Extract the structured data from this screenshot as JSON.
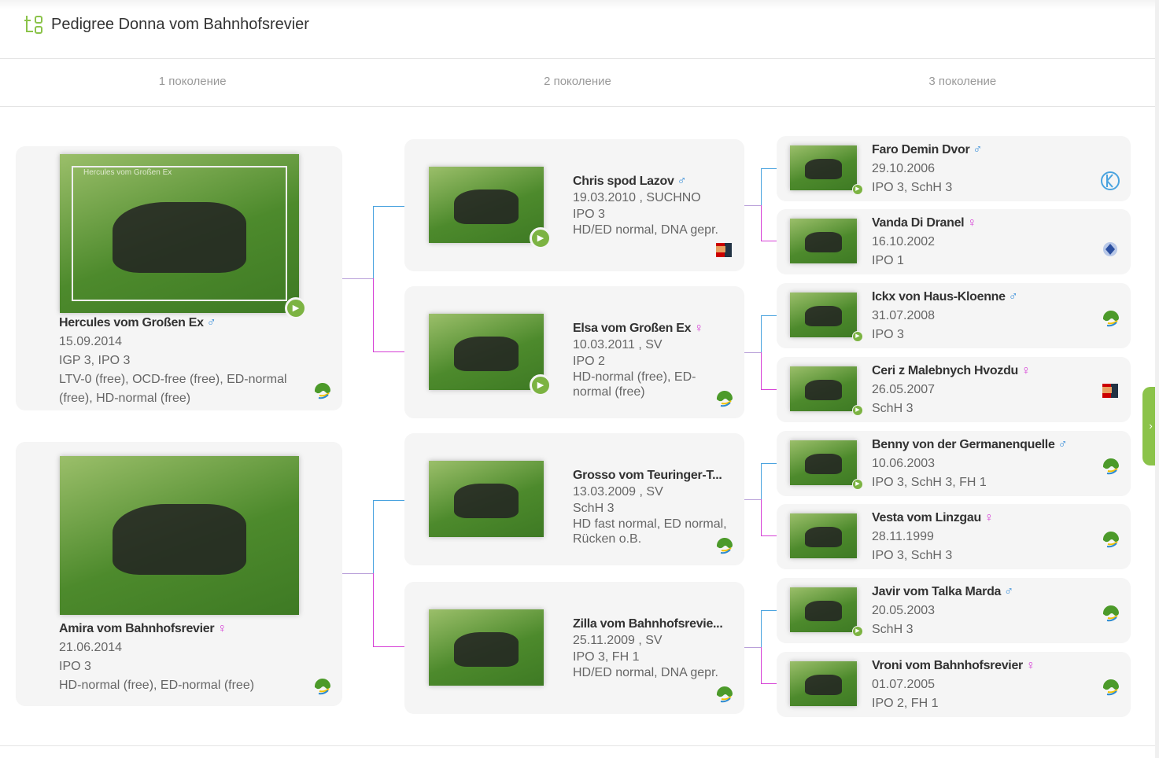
{
  "header": {
    "title": "Pedigree Donna vom Bahnhofsrevier",
    "icon": "pedigree-tree-icon"
  },
  "tabs": [
    "1 поколение",
    "2 поколение",
    "3 поколение"
  ],
  "colors": {
    "male_line": "#4aa3df",
    "female_line": "#d63fd6",
    "accent": "#8bc34a"
  },
  "gen1": [
    {
      "name": "Hercules vom Großen Ex",
      "sex": "♂",
      "lines": [
        "15.09.2014",
        "IGP 3, IPO 3",
        "LTV-0 (free), OCD-free (free), ED-normal (free), HD-normal (free)"
      ],
      "video": true,
      "club": "sv",
      "caption": "Hercules vom Großen Ex"
    },
    {
      "name": "Amira vom Bahnhofsrevier",
      "sex": "♀",
      "lines": [
        "21.06.2014",
        "IPO 3",
        "HD-normal (free), ED-normal (free)"
      ],
      "video": false,
      "club": "sv"
    }
  ],
  "gen2": [
    {
      "name": "Chris spod Lazov",
      "sex": "♂",
      "lines": [
        "19.03.2010 , SUCHNO",
        "IPO 3",
        "HD/ED normal, DNA gepr."
      ],
      "video": true,
      "club": "cmku"
    },
    {
      "name": "Elsa vom Großen Ex",
      "sex": "♀",
      "lines": [
        "10.03.2011 , SV",
        "IPO 2",
        "HD-normal (free), ED-normal (free)"
      ],
      "video": true,
      "club": "sv"
    },
    {
      "name": "Grosso vom Teuringer-T...",
      "sex": "",
      "lines": [
        "13.03.2009 , SV",
        "SchH 3",
        "HD fast normal, ED normal, Rücken o.B."
      ],
      "video": false,
      "club": "sv"
    },
    {
      "name": "Zilla vom Bahnhofsrevie...",
      "sex": "",
      "lines": [
        "25.11.2009 , SV",
        "IPO 3, FH 1",
        "HD/ED normal, DNA gepr."
      ],
      "video": false,
      "club": "sv"
    }
  ],
  "gen3": [
    {
      "name": "Faro Demin Dvor",
      "sex": "♂",
      "lines": [
        "29.10.2006",
        "IPO 3, SchH 3"
      ],
      "video": true,
      "club": "k"
    },
    {
      "name": "Vanda Di Dranel",
      "sex": "♀",
      "lines": [
        "16.10.2002",
        "IPO 1"
      ],
      "video": false,
      "club": "enci"
    },
    {
      "name": "Ickx von Haus-Kloenne",
      "sex": "♂",
      "lines": [
        "31.07.2008",
        "IPO 3"
      ],
      "video": true,
      "club": "sv"
    },
    {
      "name": "Ceri z Malebnych Hvozdu",
      "sex": "♀",
      "lines": [
        "26.05.2007",
        "SchH 3"
      ],
      "video": true,
      "club": "cmku"
    },
    {
      "name": "Benny von der Germanenquelle",
      "sex": "♂",
      "lines": [
        "10.06.2003",
        "IPO 3, SchH 3, FH 1"
      ],
      "video": true,
      "club": "sv"
    },
    {
      "name": "Vesta vom Linzgau",
      "sex": "♀",
      "lines": [
        "28.11.1999",
        "IPO 3, SchH 3"
      ],
      "video": false,
      "club": "sv"
    },
    {
      "name": "Javir vom Talka Marda",
      "sex": "♂",
      "lines": [
        "20.05.2003",
        "SchH 3"
      ],
      "video": true,
      "club": "sv"
    },
    {
      "name": "Vroni vom Bahnhofsrevier",
      "sex": "♀",
      "lines": [
        "01.07.2005",
        "IPO 2, FH 1"
      ],
      "video": false,
      "club": "sv"
    }
  ],
  "side_toggle": "›"
}
